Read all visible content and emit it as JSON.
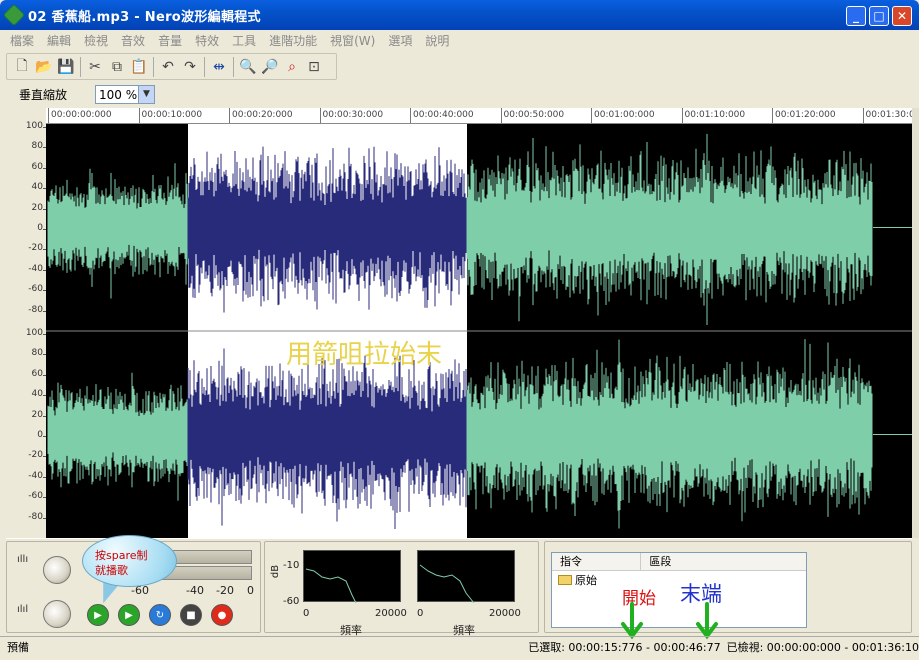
{
  "window": {
    "title": "02 香蕉船.mp3 - Nero波形編輯程式"
  },
  "menu": [
    "檔案",
    "編輯",
    "檢視",
    "音效",
    "音量",
    "特效",
    "工具",
    "進階功能",
    "視窗(W)",
    "選項",
    "說明"
  ],
  "toolbar": {
    "icons": [
      "new-icon",
      "open-icon",
      "save-icon",
      "cut-icon",
      "copy-icon",
      "paste-icon",
      "undo-icon",
      "redo-icon",
      "fit-icon",
      "zoom-in-icon",
      "zoom-out-icon",
      "zoom-selection-icon",
      "zoom-full-icon"
    ]
  },
  "zoom": {
    "label": "垂直縮放",
    "value": "100 %"
  },
  "ruler": [
    "00:00:00:000",
    "00:00:10:000",
    "00:00:20:000",
    "00:00:30:000",
    "00:00:40:000",
    "00:00:50:000",
    "00:01:00:000",
    "00:01:10:000",
    "00:01:20:000",
    "00:01:30:0"
  ],
  "amplitude_scale": [
    "100",
    "80",
    "60",
    "40",
    "20",
    "0",
    "-20",
    "-40",
    "-60",
    "-80"
  ],
  "wave": {
    "selection_label": "用箭咀拉始末",
    "selection_start_fraction": 0.164,
    "selection_end_fraction": 0.486,
    "audio_end_fraction": 0.955,
    "colors": {
      "wave": "#7fceaa",
      "selected_wave": "#282a7a",
      "selected_bg": "#ffffff",
      "bg": "#000000"
    }
  },
  "transport": {
    "bubble_lines": [
      "按spare制",
      "就播歌"
    ],
    "meter_labels": [
      "-60",
      "-40",
      "-20",
      "0"
    ],
    "buttons": [
      "play-icon",
      "play-selection-icon",
      "loop-icon",
      "stop-icon",
      "record-icon"
    ]
  },
  "spectrum": {
    "db_label": "dB",
    "y_ticks": [
      "-10",
      "-60"
    ],
    "x_ticks": [
      "0",
      "20000"
    ],
    "x_label": "頻率"
  },
  "commands": {
    "headers": [
      "指令",
      "區段"
    ],
    "rows": [
      {
        "name": "原始"
      }
    ],
    "annotation_start": "開始",
    "annotation_end": "末端"
  },
  "status": {
    "left": "預備",
    "selected": "已選取: 00:00:15:776 - 00:00:46:77",
    "checked": "已檢視: 00:00:00:000 - 00:01:36:10"
  }
}
